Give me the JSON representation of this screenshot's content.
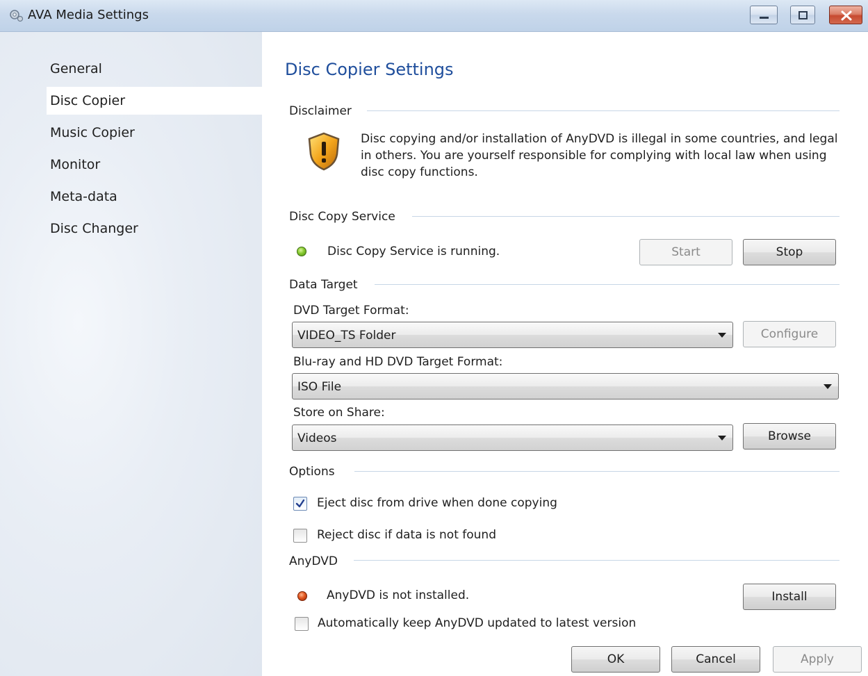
{
  "window": {
    "title": "AVA Media Settings",
    "icon": "gear-icon",
    "controls": [
      "minimize-icon",
      "maximize-icon",
      "close-icon"
    ]
  },
  "sidebar": {
    "items": [
      {
        "label": "General",
        "active": false
      },
      {
        "label": "Disc Copier",
        "active": true
      },
      {
        "label": "Music Copier",
        "active": false
      },
      {
        "label": "Monitor",
        "active": false
      },
      {
        "label": "Meta-data",
        "active": false
      },
      {
        "label": "Disc Changer",
        "active": false
      }
    ]
  },
  "page": {
    "title": "Disc Copier Settings"
  },
  "disclaimer": {
    "heading": "Disclaimer",
    "icon": "shield-warning-icon",
    "text": "Disc copying and/or installation of AnyDVD is illegal in some countries, and legal in others. You are yourself responsible for complying with local law when using disc copy functions."
  },
  "service": {
    "heading": "Disc Copy Service",
    "status_text": "Disc Copy Service is running.",
    "status_color": "#6bb523",
    "start_label": "Start",
    "stop_label": "Stop"
  },
  "data_target": {
    "heading": "Data Target",
    "dvd_label": "DVD Target Format:",
    "dvd_value": "VIDEO_TS Folder",
    "configure_label": "Configure",
    "bluray_label": "Blu-ray and HD DVD Target Format:",
    "bluray_value": "ISO File",
    "share_label": "Store on Share:",
    "share_value": "Videos",
    "browse_label": "Browse"
  },
  "options": {
    "heading": "Options",
    "eject_label": "Eject disc from drive when done copying",
    "eject_checked": true,
    "reject_label": "Reject disc if data is not found",
    "reject_checked": false
  },
  "anydvd": {
    "heading": "AnyDVD",
    "status_text": "AnyDVD is not installed.",
    "status_color": "#d24a17",
    "install_label": "Install",
    "auto_update_label": "Automatically keep AnyDVD updated to latest version",
    "auto_update_checked": false
  },
  "footer": {
    "ok_label": "OK",
    "cancel_label": "Cancel",
    "apply_label": "Apply"
  }
}
